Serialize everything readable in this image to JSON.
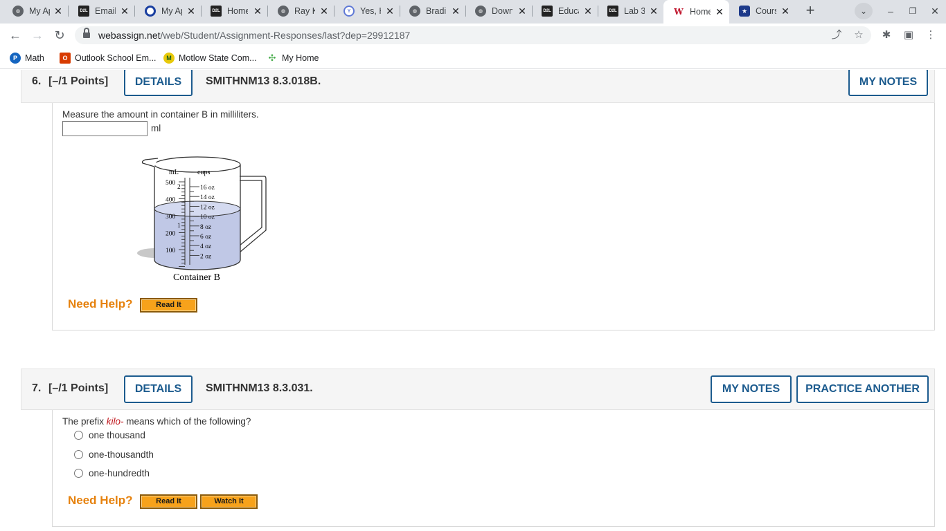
{
  "browser": {
    "tabs": [
      {
        "label": "My Ap",
        "icon": "globe-icon"
      },
      {
        "label": "Email",
        "icon": "d2l-icon"
      },
      {
        "label": "My Ap",
        "icon": "ring-icon"
      },
      {
        "label": "Home",
        "icon": "d2l-icon"
      },
      {
        "label": "Ray K",
        "icon": "globe-icon"
      },
      {
        "label": "Yes, H",
        "icon": "ya-icon"
      },
      {
        "label": "Bradi",
        "icon": "globe-icon"
      },
      {
        "label": "Down",
        "icon": "globe-icon"
      },
      {
        "label": "Educa",
        "icon": "d2l-icon"
      },
      {
        "label": "Lab 3",
        "icon": "d2l-icon"
      },
      {
        "label": "Home",
        "icon": "webassign-icon",
        "active": true
      },
      {
        "label": "Cours",
        "icon": "shield-icon"
      }
    ],
    "url_host": "webassign.net",
    "url_path": "/web/Student/Assignment-Responses/last?dep=29912187",
    "bookmarks": [
      {
        "label": "Math",
        "icon": "p-icon",
        "color": "#1565c0"
      },
      {
        "label": "Outlook School Em...",
        "icon": "office-icon",
        "color": "#d83b01"
      },
      {
        "label": "Motlow State Com...",
        "icon": "motlow-icon",
        "color": "#2e7d32"
      },
      {
        "label": "My Home",
        "icon": "pinwheel-icon",
        "color": "#4caf50"
      }
    ]
  },
  "q6": {
    "number": "6.",
    "points": "[–/1 Points]",
    "details_label": "DETAILS",
    "code": "SMITHNM13 8.3.018B.",
    "notes_label": "MY NOTES",
    "prompt": "Measure the amount in container B in milliliters.",
    "answer_value": "",
    "unit": "ml",
    "figure": {
      "ml_label": "mL",
      "cups_label": "cups",
      "ml_ticks": [
        "500",
        "400",
        "300",
        "200",
        "100"
      ],
      "oz_ticks": [
        "16 oz",
        "14 oz",
        "12 oz",
        "10 oz",
        "8 oz",
        "6 oz",
        "4 oz",
        "2 oz"
      ],
      "cup_ticks": [
        "2",
        "1"
      ],
      "caption": "Container B"
    },
    "need_help": "Need Help?",
    "read_it": "Read It"
  },
  "q7": {
    "number": "7.",
    "points": "[–/1 Points]",
    "details_label": "DETAILS",
    "code": "SMITHNM13 8.3.031.",
    "notes_label": "MY NOTES",
    "practice_label": "PRACTICE ANOTHER",
    "prompt_before": "The prefix ",
    "prompt_term": "kilo-",
    "prompt_after": " means which of the following?",
    "choices": [
      "one thousand",
      "one-thousandth",
      "one-hundredth"
    ],
    "need_help": "Need Help?",
    "read_it": "Read It",
    "watch_it": "Watch It"
  }
}
